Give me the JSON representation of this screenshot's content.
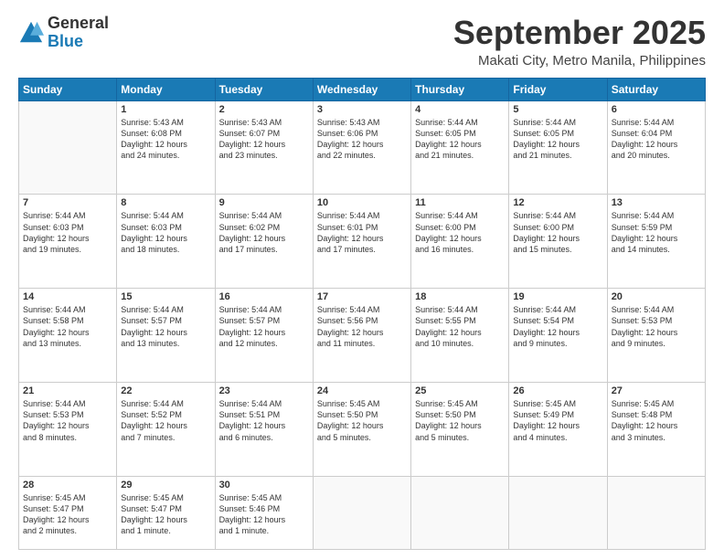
{
  "logo": {
    "general": "General",
    "blue": "Blue"
  },
  "header": {
    "month": "September 2025",
    "location": "Makati City, Metro Manila, Philippines"
  },
  "weekdays": [
    "Sunday",
    "Monday",
    "Tuesday",
    "Wednesday",
    "Thursday",
    "Friday",
    "Saturday"
  ],
  "weeks": [
    [
      {
        "day": "",
        "sunrise": "",
        "sunset": "",
        "daylight": ""
      },
      {
        "day": "1",
        "sunrise": "Sunrise: 5:43 AM",
        "sunset": "Sunset: 6:08 PM",
        "daylight": "Daylight: 12 hours and 24 minutes."
      },
      {
        "day": "2",
        "sunrise": "Sunrise: 5:43 AM",
        "sunset": "Sunset: 6:07 PM",
        "daylight": "Daylight: 12 hours and 23 minutes."
      },
      {
        "day": "3",
        "sunrise": "Sunrise: 5:43 AM",
        "sunset": "Sunset: 6:06 PM",
        "daylight": "Daylight: 12 hours and 22 minutes."
      },
      {
        "day": "4",
        "sunrise": "Sunrise: 5:44 AM",
        "sunset": "Sunset: 6:05 PM",
        "daylight": "Daylight: 12 hours and 21 minutes."
      },
      {
        "day": "5",
        "sunrise": "Sunrise: 5:44 AM",
        "sunset": "Sunset: 6:05 PM",
        "daylight": "Daylight: 12 hours and 21 minutes."
      },
      {
        "day": "6",
        "sunrise": "Sunrise: 5:44 AM",
        "sunset": "Sunset: 6:04 PM",
        "daylight": "Daylight: 12 hours and 20 minutes."
      }
    ],
    [
      {
        "day": "7",
        "sunrise": "Sunrise: 5:44 AM",
        "sunset": "Sunset: 6:03 PM",
        "daylight": "Daylight: 12 hours and 19 minutes."
      },
      {
        "day": "8",
        "sunrise": "Sunrise: 5:44 AM",
        "sunset": "Sunset: 6:03 PM",
        "daylight": "Daylight: 12 hours and 18 minutes."
      },
      {
        "day": "9",
        "sunrise": "Sunrise: 5:44 AM",
        "sunset": "Sunset: 6:02 PM",
        "daylight": "Daylight: 12 hours and 17 minutes."
      },
      {
        "day": "10",
        "sunrise": "Sunrise: 5:44 AM",
        "sunset": "Sunset: 6:01 PM",
        "daylight": "Daylight: 12 hours and 17 minutes."
      },
      {
        "day": "11",
        "sunrise": "Sunrise: 5:44 AM",
        "sunset": "Sunset: 6:00 PM",
        "daylight": "Daylight: 12 hours and 16 minutes."
      },
      {
        "day": "12",
        "sunrise": "Sunrise: 5:44 AM",
        "sunset": "Sunset: 6:00 PM",
        "daylight": "Daylight: 12 hours and 15 minutes."
      },
      {
        "day": "13",
        "sunrise": "Sunrise: 5:44 AM",
        "sunset": "Sunset: 5:59 PM",
        "daylight": "Daylight: 12 hours and 14 minutes."
      }
    ],
    [
      {
        "day": "14",
        "sunrise": "Sunrise: 5:44 AM",
        "sunset": "Sunset: 5:58 PM",
        "daylight": "Daylight: 12 hours and 13 minutes."
      },
      {
        "day": "15",
        "sunrise": "Sunrise: 5:44 AM",
        "sunset": "Sunset: 5:57 PM",
        "daylight": "Daylight: 12 hours and 13 minutes."
      },
      {
        "day": "16",
        "sunrise": "Sunrise: 5:44 AM",
        "sunset": "Sunset: 5:57 PM",
        "daylight": "Daylight: 12 hours and 12 minutes."
      },
      {
        "day": "17",
        "sunrise": "Sunrise: 5:44 AM",
        "sunset": "Sunset: 5:56 PM",
        "daylight": "Daylight: 12 hours and 11 minutes."
      },
      {
        "day": "18",
        "sunrise": "Sunrise: 5:44 AM",
        "sunset": "Sunset: 5:55 PM",
        "daylight": "Daylight: 12 hours and 10 minutes."
      },
      {
        "day": "19",
        "sunrise": "Sunrise: 5:44 AM",
        "sunset": "Sunset: 5:54 PM",
        "daylight": "Daylight: 12 hours and 9 minutes."
      },
      {
        "day": "20",
        "sunrise": "Sunrise: 5:44 AM",
        "sunset": "Sunset: 5:53 PM",
        "daylight": "Daylight: 12 hours and 9 minutes."
      }
    ],
    [
      {
        "day": "21",
        "sunrise": "Sunrise: 5:44 AM",
        "sunset": "Sunset: 5:53 PM",
        "daylight": "Daylight: 12 hours and 8 minutes."
      },
      {
        "day": "22",
        "sunrise": "Sunrise: 5:44 AM",
        "sunset": "Sunset: 5:52 PM",
        "daylight": "Daylight: 12 hours and 7 minutes."
      },
      {
        "day": "23",
        "sunrise": "Sunrise: 5:44 AM",
        "sunset": "Sunset: 5:51 PM",
        "daylight": "Daylight: 12 hours and 6 minutes."
      },
      {
        "day": "24",
        "sunrise": "Sunrise: 5:45 AM",
        "sunset": "Sunset: 5:50 PM",
        "daylight": "Daylight: 12 hours and 5 minutes."
      },
      {
        "day": "25",
        "sunrise": "Sunrise: 5:45 AM",
        "sunset": "Sunset: 5:50 PM",
        "daylight": "Daylight: 12 hours and 5 minutes."
      },
      {
        "day": "26",
        "sunrise": "Sunrise: 5:45 AM",
        "sunset": "Sunset: 5:49 PM",
        "daylight": "Daylight: 12 hours and 4 minutes."
      },
      {
        "day": "27",
        "sunrise": "Sunrise: 5:45 AM",
        "sunset": "Sunset: 5:48 PM",
        "daylight": "Daylight: 12 hours and 3 minutes."
      }
    ],
    [
      {
        "day": "28",
        "sunrise": "Sunrise: 5:45 AM",
        "sunset": "Sunset: 5:47 PM",
        "daylight": "Daylight: 12 hours and 2 minutes."
      },
      {
        "day": "29",
        "sunrise": "Sunrise: 5:45 AM",
        "sunset": "Sunset: 5:47 PM",
        "daylight": "Daylight: 12 hours and 1 minute."
      },
      {
        "day": "30",
        "sunrise": "Sunrise: 5:45 AM",
        "sunset": "Sunset: 5:46 PM",
        "daylight": "Daylight: 12 hours and 1 minute."
      },
      {
        "day": "",
        "sunrise": "",
        "sunset": "",
        "daylight": ""
      },
      {
        "day": "",
        "sunrise": "",
        "sunset": "",
        "daylight": ""
      },
      {
        "day": "",
        "sunrise": "",
        "sunset": "",
        "daylight": ""
      },
      {
        "day": "",
        "sunrise": "",
        "sunset": "",
        "daylight": ""
      }
    ]
  ]
}
